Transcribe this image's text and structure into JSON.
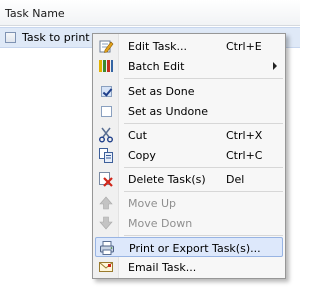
{
  "table": {
    "column_header": "Task Name",
    "rows": [
      {
        "label": "Task to print",
        "checked": false
      }
    ]
  },
  "context_menu": {
    "items": [
      {
        "label": "Edit Task...",
        "shortcut": "Ctrl+E",
        "icon": "edit-task-icon",
        "enabled": true
      },
      {
        "label": "Batch Edit",
        "shortcut": "",
        "icon": "batch-edit-icon",
        "enabled": true,
        "submenu": true
      },
      {
        "label": "Set as Done",
        "shortcut": "",
        "icon": "checked-checkbox-icon",
        "enabled": true
      },
      {
        "label": "Set as Undone",
        "shortcut": "",
        "icon": "unchecked-checkbox-icon",
        "enabled": true
      },
      {
        "label": "Cut",
        "shortcut": "Ctrl+X",
        "icon": "scissors-icon",
        "enabled": true
      },
      {
        "label": "Copy",
        "shortcut": "Ctrl+C",
        "icon": "copy-icon",
        "enabled": true
      },
      {
        "label": "Delete Task(s)",
        "shortcut": "Del",
        "icon": "delete-icon",
        "enabled": true
      },
      {
        "label": "Move Up",
        "shortcut": "",
        "icon": "arrow-up-icon",
        "enabled": false
      },
      {
        "label": "Move Down",
        "shortcut": "",
        "icon": "arrow-down-icon",
        "enabled": false
      },
      {
        "label": "Print or Export Task(s)...",
        "shortcut": "",
        "icon": "print-icon",
        "enabled": true,
        "highlighted": true
      },
      {
        "label": "Email Task...",
        "shortcut": "",
        "icon": "email-icon",
        "enabled": true
      }
    ]
  },
  "colors": {
    "selection": "#dfe9f7",
    "menu_highlight": "#dde8fb",
    "disabled_text": "#8f8f8f"
  }
}
